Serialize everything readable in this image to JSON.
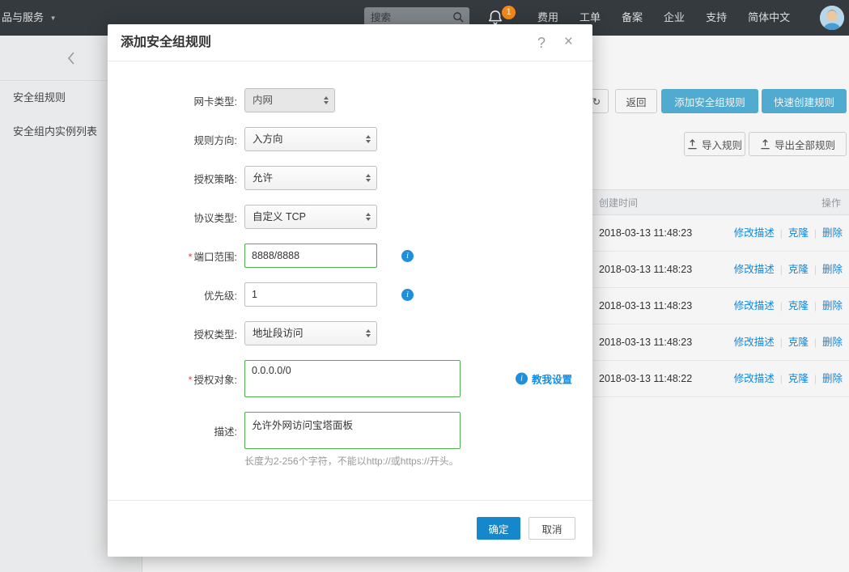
{
  "colors": {
    "topbar": "#373d41",
    "accent_light": "#55b1d9",
    "primary": "#1787cc",
    "link": "#108ee9",
    "valid_green": "#4caf50",
    "badge_orange": "#ff8e1c"
  },
  "topbar": {
    "product_menu": "品与服务",
    "caret": "▼",
    "search_placeholder": "搜索",
    "notification_count": "1",
    "menu": [
      "费用",
      "工单",
      "备案",
      "企业",
      "支持",
      "简体中文"
    ]
  },
  "sidebar": {
    "items": [
      "安全组规则",
      "安全组内实例列表"
    ]
  },
  "content": {
    "toolbar": {
      "refresh": "↻",
      "back": "返回",
      "add_rule": "添加安全组规则",
      "quick_create": "快速创建规则",
      "import_rules": "导入规则",
      "export_rules": "导出全部规则"
    },
    "table": {
      "headers": [
        "创建时间",
        "操作"
      ],
      "separator": "|",
      "actions": [
        "修改描述",
        "克隆",
        "删除"
      ],
      "rows": [
        {
          "created": "2018-03-13 11:48:23"
        },
        {
          "created": "2018-03-13 11:48:23"
        },
        {
          "created": "2018-03-13 11:48:23"
        },
        {
          "created": "2018-03-13 11:48:23"
        },
        {
          "created": "2018-03-13 11:48:22"
        }
      ]
    }
  },
  "modal": {
    "title": "添加安全组规则",
    "help_icon": "?",
    "close_icon": "×",
    "required_mark": "*",
    "info_icon": "i",
    "fields": {
      "nic": {
        "label": "网卡类型:",
        "value": "内网"
      },
      "direction": {
        "label": "规则方向:",
        "value": "入方向"
      },
      "policy": {
        "label": "授权策略:",
        "value": "允许"
      },
      "protocol": {
        "label": "协议类型:",
        "value": "自定义 TCP"
      },
      "port": {
        "label": "端口范围:",
        "value": "8888/8888"
      },
      "priority": {
        "label": "优先级:",
        "value": "1"
      },
      "auth_type": {
        "label": "授权类型:",
        "value": "地址段访问"
      },
      "target": {
        "label": "授权对象:",
        "value": "0.0.0.0/0",
        "link": "教我设置"
      },
      "desc": {
        "label": "描述:",
        "value": "允许外网访问宝塔面板",
        "hint": "长度为2-256个字符，不能以http://或https://开头。"
      }
    },
    "footer": {
      "ok": "确定",
      "cancel": "取消"
    }
  }
}
